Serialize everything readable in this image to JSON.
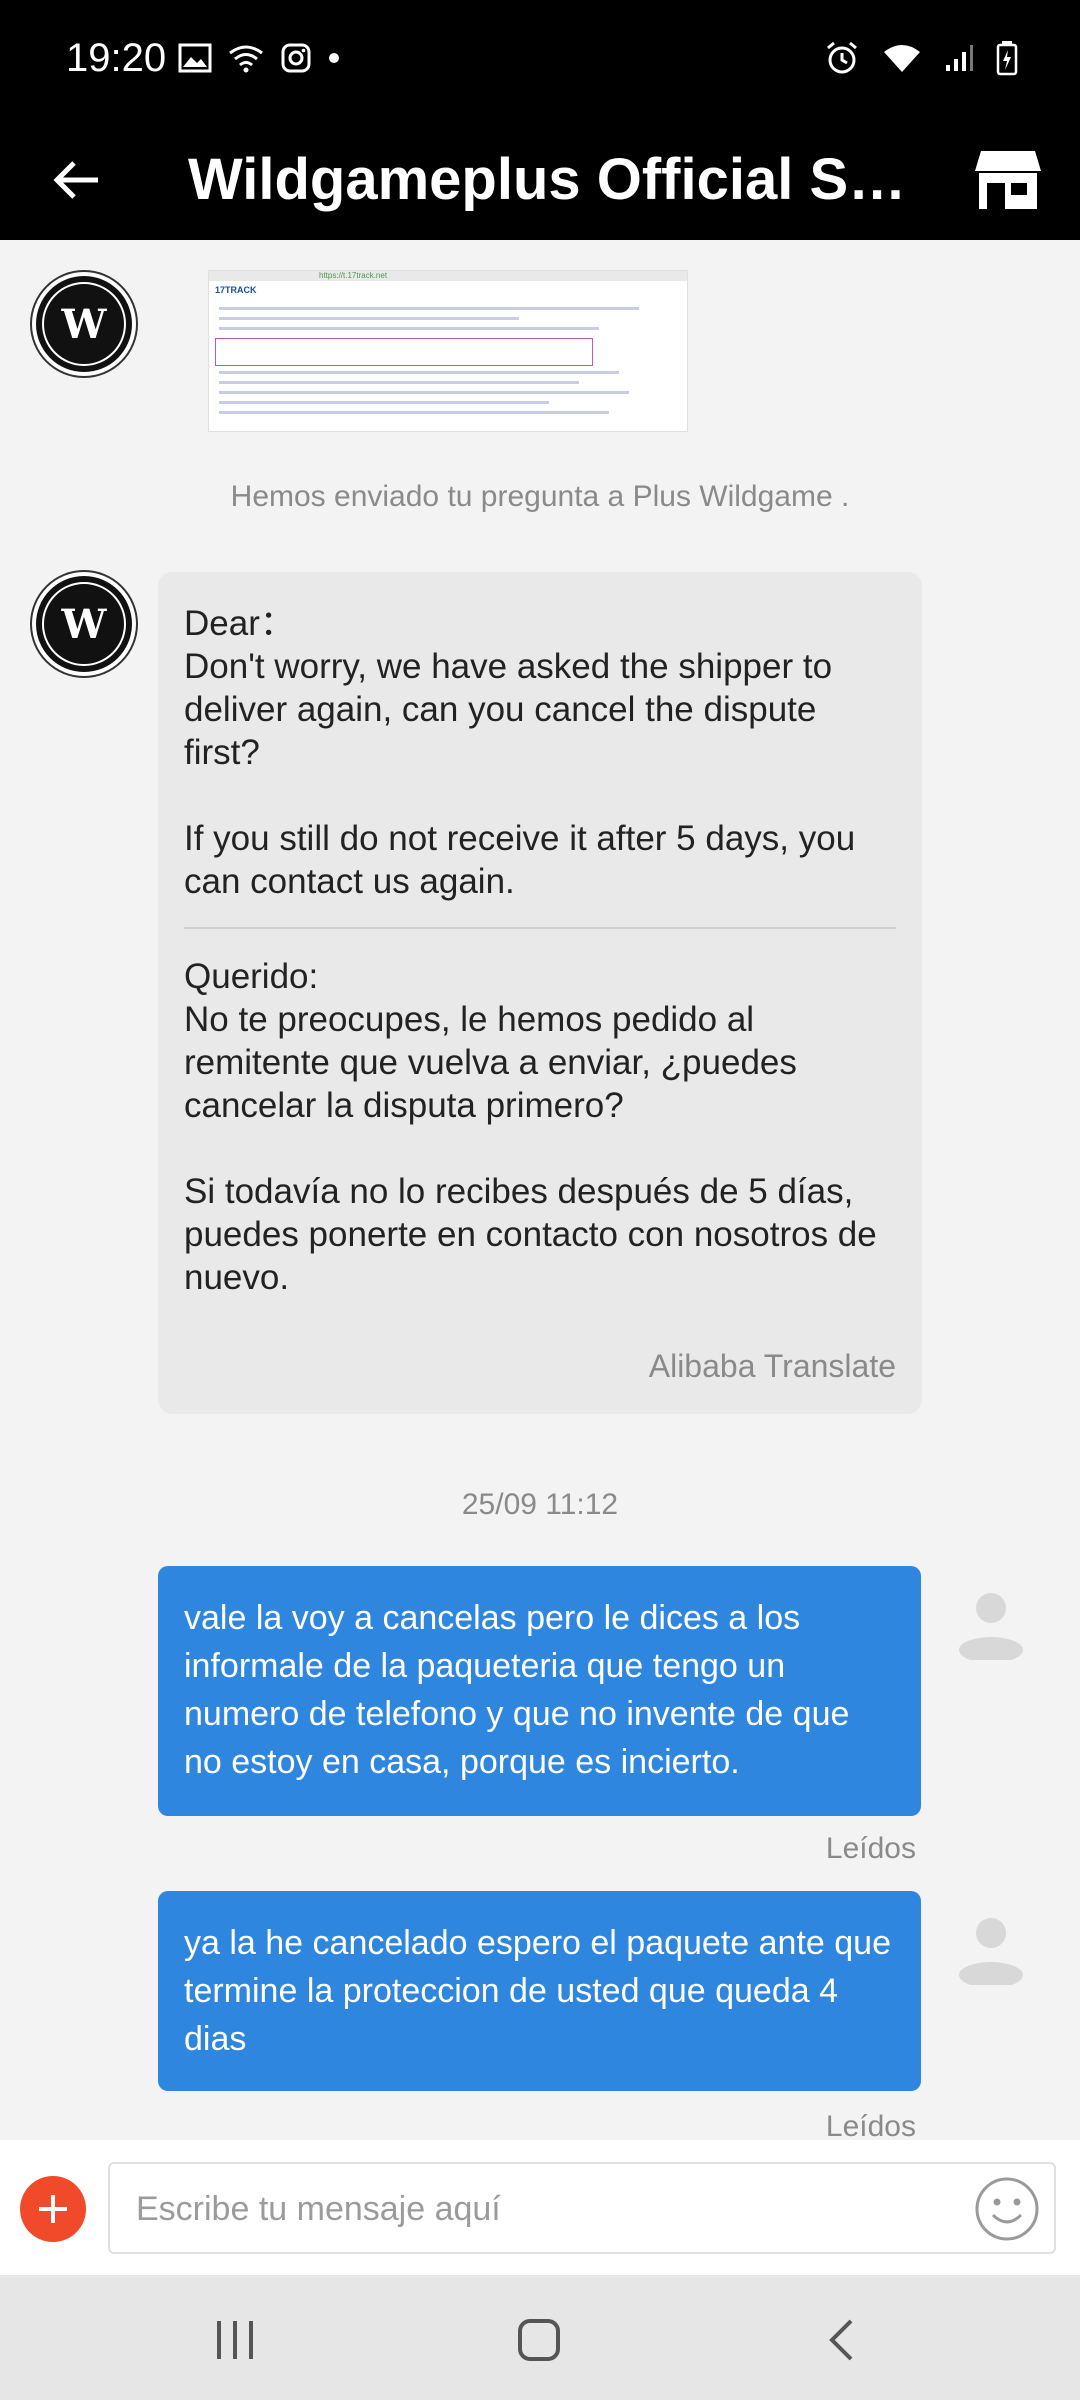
{
  "status_bar": {
    "time": "19:20",
    "left_icons": [
      "image-icon",
      "wifi-calling-icon",
      "instagram-icon",
      "dot-icon"
    ],
    "right_icons": [
      "alarm-icon",
      "wifi-icon",
      "signal-icon",
      "battery-icon"
    ]
  },
  "header": {
    "title": "Wildgameplus Official St...",
    "back_icon": "arrow-left-icon",
    "store_icon": "store-icon"
  },
  "chat": {
    "screenshot_preview": {
      "brand": "17TRACK",
      "url": "https://t.17track.net"
    },
    "system_notice": "Hemos enviado tu pregunta a Plus Wildgame .",
    "incoming_message": {
      "original": "Dear：\nDon't worry, we have asked the shipper to deliver again, can you cancel the dispute first?\n\nIf you still do not receive it after 5 days, you can contact us again.",
      "translated": "Querido:\nNo te preocupes, le hemos pedido al remitente que vuelva a enviar, ¿puedes cancelar la disputa primero?\n\nSi todavía no lo recibes después de 5 días, puedes ponerte en contacto con nosotros de nuevo.",
      "translator": "Alibaba Translate"
    },
    "timestamp": "25/09 11:12",
    "outgoing_messages": [
      {
        "text": "vale la voy a cancelas pero le dices a los informale de la paqueteria que tengo un numero de telefono y que no invente de que no estoy en casa, porque es incierto.",
        "status": "Leídos"
      },
      {
        "text": "ya la he cancelado espero el paquete ante que termine la proteccion de usted que queda 4 dias",
        "status": "Leídos"
      }
    ]
  },
  "input_bar": {
    "placeholder": "Escribe tu mensaje aquí",
    "add_icon": "plus-icon",
    "emoji_icon": "smiley-icon"
  },
  "nav_bar": {
    "icons": [
      "recent-apps-icon",
      "home-icon",
      "back-icon"
    ]
  },
  "colors": {
    "header_bg": "#000000",
    "outgoing_bubble": "#2e86de",
    "incoming_bubble": "#e9e9e9",
    "plus_button": "#f04a2a"
  }
}
